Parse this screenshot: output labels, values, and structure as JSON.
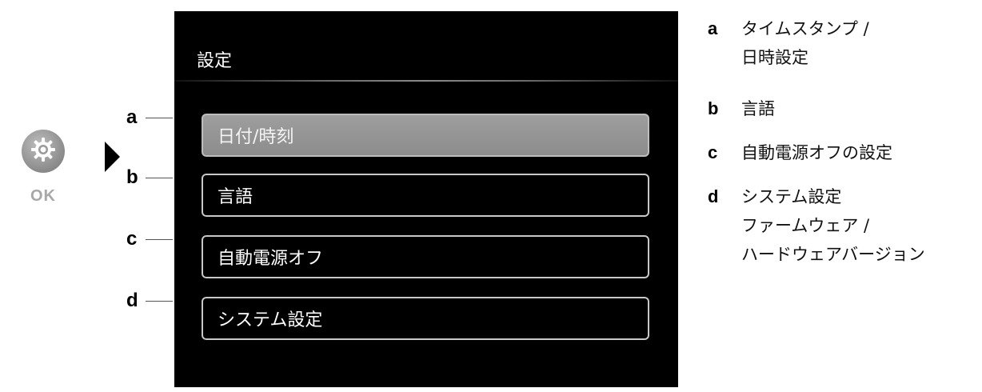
{
  "ok_button": {
    "icon": "gear-icon",
    "label": "OK"
  },
  "arrow": {
    "icon": "play-arrow-icon"
  },
  "screen": {
    "title": "設定",
    "items": [
      {
        "letter": "a",
        "label": "日付/時刻",
        "selected": true
      },
      {
        "letter": "b",
        "label": "言語",
        "selected": false
      },
      {
        "letter": "c",
        "label": "自動電源オフ",
        "selected": false
      },
      {
        "letter": "d",
        "label": "システム設定",
        "selected": false
      }
    ]
  },
  "legend": [
    {
      "letter": "a",
      "lines": [
        "タイムスタンプ /",
        "日時設定"
      ]
    },
    {
      "letter": "b",
      "lines": [
        "言語"
      ]
    },
    {
      "letter": "c",
      "lines": [
        "自動電源オフの設定"
      ]
    },
    {
      "letter": "d",
      "lines": [
        "システム設定",
        "ファームウェア /",
        "ハードウェアバージョン"
      ]
    }
  ],
  "colors": {
    "screen_background": "#000000",
    "selected_item": "#9e9e9e",
    "item_border": "#c8c8c8",
    "ok_button": "#8a8a8a"
  }
}
